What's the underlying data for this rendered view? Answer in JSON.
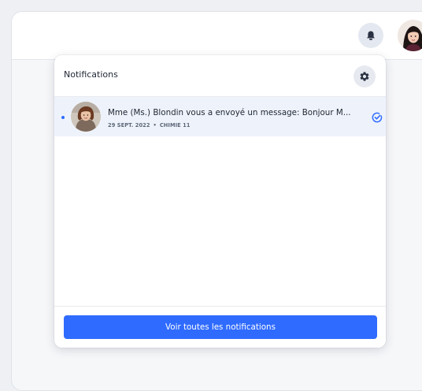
{
  "header": {
    "bell_icon": "bell-icon",
    "user_avatar": "user-avatar"
  },
  "panel": {
    "title": "Notifications",
    "settings_icon": "gear-icon",
    "notifications": [
      {
        "unread": true,
        "message": "Mme (Ms.) Blondin vous a envoyé un message: Bonjour M...",
        "date": "29 SEPT. 2022",
        "separator": "•",
        "course": "CHIMIE 11",
        "action_icon": "check-circle-icon"
      }
    ],
    "view_all_label": "Voir toutes les notifications"
  },
  "colors": {
    "accent": "#2f6bff",
    "unread_row_bg": "#eef3fb",
    "page_bg": "#f6f7f9"
  }
}
